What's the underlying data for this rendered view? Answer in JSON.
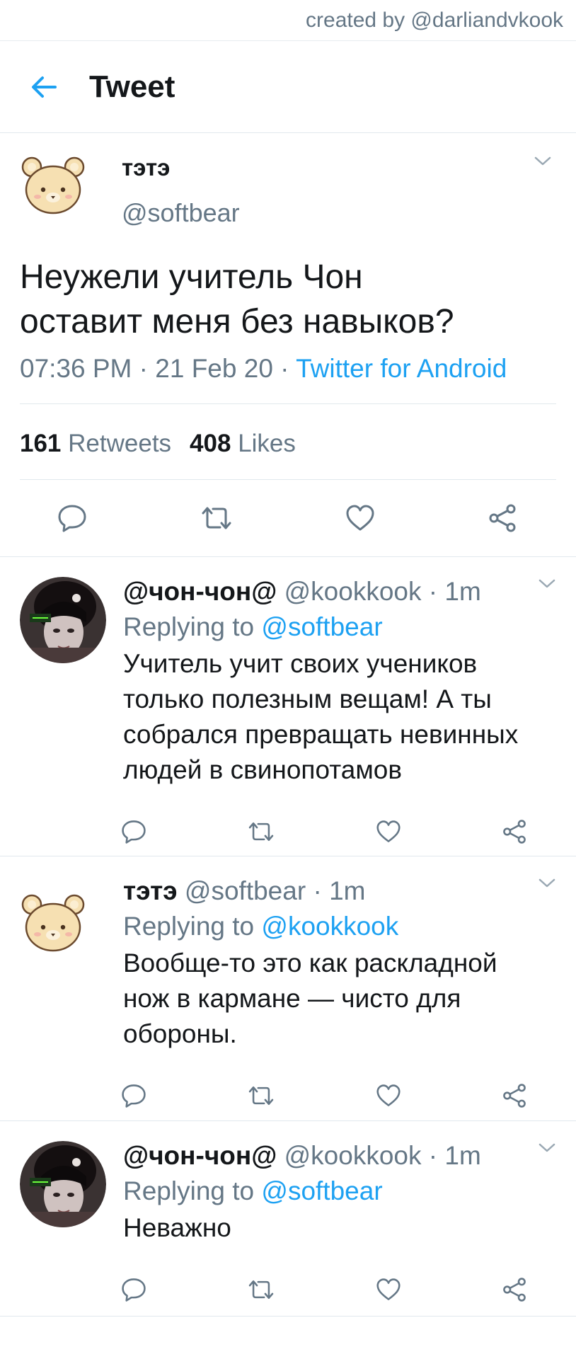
{
  "credit": "created by @darliandvkook",
  "header": {
    "title": "Tweet",
    "back_icon": "arrow-left-icon"
  },
  "main_tweet": {
    "name": "тэтэ",
    "handle": "@softbear",
    "text_line1": "Неужели учитель Чон",
    "text_line2": "оставит меня без навыков?",
    "time": "07:36 PM",
    "sep1": " · ",
    "date": "21 Feb 20",
    "sep2": " · ",
    "client": "Twitter for Android",
    "retweets_count": "161",
    "retweets_label": "Retweets",
    "likes_count": "408",
    "likes_label": "Likes"
  },
  "replies": [
    {
      "name": "@чон-чон@",
      "handle": "@kookkook",
      "sep": " · ",
      "time": "1m",
      "replying_prefix": "Replying to ",
      "replying_to": "@softbear",
      "lines": [
        "Учитель учит своих учеников",
        "только полезным вещам! А ты",
        "собрался превращать невинных",
        "людей в свинопотамов"
      ]
    },
    {
      "name": "тэтэ",
      "handle": "@softbear",
      "sep": " · ",
      "time": "1m",
      "replying_prefix": "Replying to ",
      "replying_to": "@kookkook",
      "lines": [
        "Вообще-то это как раскладной",
        "нож в кармане — чисто для",
        "обороны."
      ]
    },
    {
      "name": "@чон-чон@",
      "handle": "@kookkook",
      "sep": " · ",
      "time": "1m",
      "replying_prefix": "Replying to ",
      "replying_to": "@softbear",
      "lines": [
        "Неважно"
      ]
    }
  ],
  "colors": {
    "accent": "#1da1f2",
    "secondary_text": "#657786",
    "border": "#e1e8ed"
  }
}
